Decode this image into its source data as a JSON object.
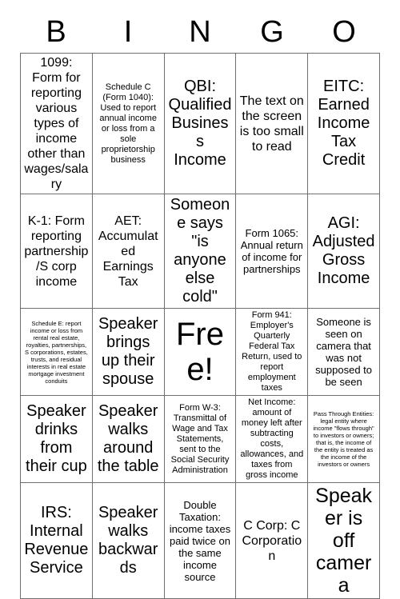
{
  "card": {
    "header_letters": [
      "B",
      "I",
      "N",
      "G",
      "O"
    ],
    "free_space_label": "Free!",
    "rows": [
      [
        {
          "text": "1099: Form for reporting various types of income other than wages/salary",
          "size": "fs-l"
        },
        {
          "text": "Schedule C (Form 1040): Used to report annual income or loss from a sole proprietorship business",
          "size": "fs-s"
        },
        {
          "text": "QBI: Qualified Business Income",
          "size": "fs-xl"
        },
        {
          "text": "The text on the screen is too small to read",
          "size": "fs-l"
        },
        {
          "text": "EITC: Earned Income Tax Credit",
          "size": "fs-xl"
        }
      ],
      [
        {
          "text": "K-1: Form reporting partnership/S corp income",
          "size": "fs-l"
        },
        {
          "text": "AET: Accumulated Earnings Tax",
          "size": "fs-l"
        },
        {
          "text": "Someone says \"is anyone else cold\"",
          "size": "fs-xl"
        },
        {
          "text": "Form 1065: Annual return of income for partnerships",
          "size": "fs-m"
        },
        {
          "text": "AGI: Adjusted Gross Income",
          "size": "fs-xl"
        }
      ],
      [
        {
          "text": "Schedule E: report income or loss from rental real estate, royalties, partnerships, S corporations, estates, trusts, and residual interests in real estate mortgage investment conduits",
          "size": "fs-xxs"
        },
        {
          "text": "Speaker brings up their spouse",
          "size": "fs-xl"
        },
        {
          "text": "Free!",
          "size": "free-cell",
          "is_free": true
        },
        {
          "text": "Form 941: Employer's Quarterly Federal Tax Return, used to report employment taxes",
          "size": "fs-s"
        },
        {
          "text": "Someone is seen on camera that was not supposed to be seen",
          "size": "fs-m"
        }
      ],
      [
        {
          "text": "Speaker drinks from their cup",
          "size": "fs-xl"
        },
        {
          "text": "Speaker walks around the table",
          "size": "fs-xl"
        },
        {
          "text": "Form W-3: Transmittal of Wage and Tax Statements, sent to the Social Security Administration",
          "size": "fs-s"
        },
        {
          "text": "Net Income: amount of money left after subtracting costs, allowances, and taxes from gross income",
          "size": "fs-s"
        },
        {
          "text": "Pass Through Entities: legal entity where income \"flows through\" to investors or owners; that is, the income of the entity is treated as the income of the investors or owners",
          "size": "fs-xxs"
        }
      ],
      [
        {
          "text": "IRS: Internal Revenue Service",
          "size": "fs-xl"
        },
        {
          "text": "Speaker walks backwards",
          "size": "fs-xl"
        },
        {
          "text": "Double Taxation: income taxes paid twice on the same income source",
          "size": "fs-m"
        },
        {
          "text": "C Corp: C Corporation",
          "size": "fs-l"
        },
        {
          "text": "Speaker is off camera",
          "size": "fs-xxl"
        }
      ]
    ]
  },
  "colors": {
    "background": "#ffffff",
    "text": "#000000",
    "grid_line": "#6f6f6f"
  }
}
